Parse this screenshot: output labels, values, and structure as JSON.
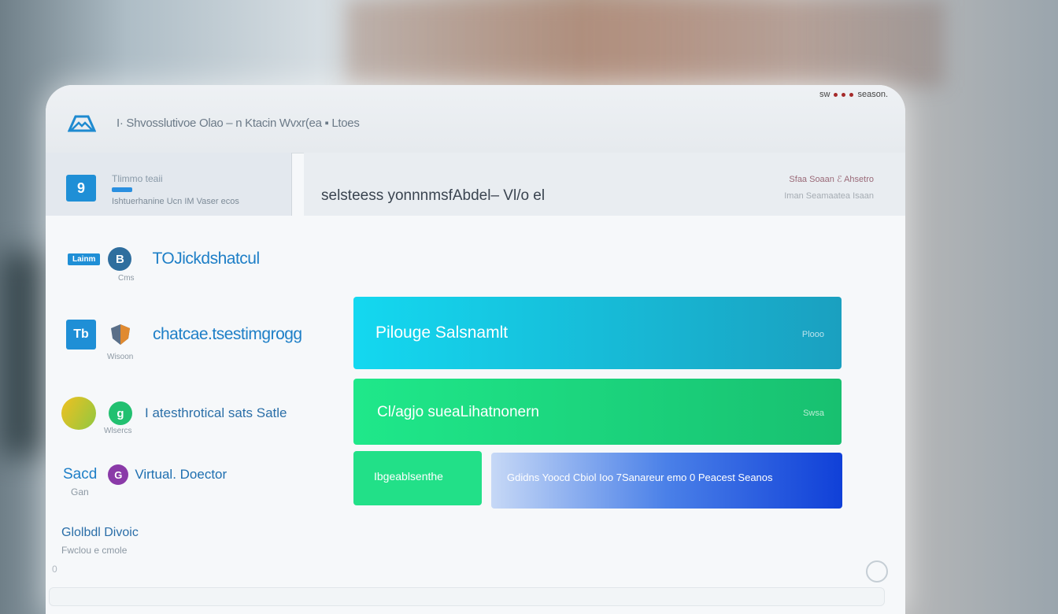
{
  "status": {
    "text_left": "sw",
    "text_right": "season."
  },
  "header": {
    "title": "I· Shvosslutivoe Olao –  n  Ktacin Wvxr(ea  ▪ Ltoes"
  },
  "profile": {
    "badge": "9",
    "name": "Tlimmo teaii",
    "subtitle": "Ishtuerhanine Ucn IM Vaser ecos"
  },
  "search": {
    "query": "selsteess yonnnmsfAbdel– Vl/o el",
    "meta_row1": "Sfaa   Soaan   ℰ Ahsetro",
    "meta_row2": "Iman   Seamaatea   Isaan"
  },
  "nav": [
    {
      "pill": "Lainm",
      "circle": "B",
      "caption": "Cms",
      "label": "TOJickdshatcul"
    },
    {
      "badge": "Tb",
      "caption": "Wisoon",
      "label": "chatcae.tsestimgrogg"
    },
    {
      "circle": "g",
      "caption": "Wlsercs",
      "label": "I atesthrotical sats  Satle"
    },
    {
      "lead": "Sacd",
      "lead_caption": "Gan",
      "circle": "G",
      "label": "Virtual. Doector"
    }
  ],
  "footer": {
    "title": "Glolbdl Divoic",
    "subtitle": "Fwclou e cmole",
    "counter": "0"
  },
  "cards": {
    "card1": {
      "label": "Pilouge  Salsnamlt",
      "right": "Plooo"
    },
    "card2": {
      "label": "Cl/agjo sueaLihatnonern",
      "right": "Swsa"
    },
    "card3": {
      "label": "Ibgeablsenthe"
    },
    "card4": {
      "label": "Gdidns Yoocd   Cbiol Ioo   7Sanareur emo   0   Peacest Seanos"
    }
  },
  "colors": {
    "accent": "#1e7fc7",
    "card1_from": "#14d8f0",
    "card1_to": "#1aa0c0",
    "card2_from": "#1fe88a",
    "card2_to": "#18c070",
    "card3": "#22e088",
    "card4_from": "#c6d8f6",
    "card4_to": "#1040d8"
  }
}
